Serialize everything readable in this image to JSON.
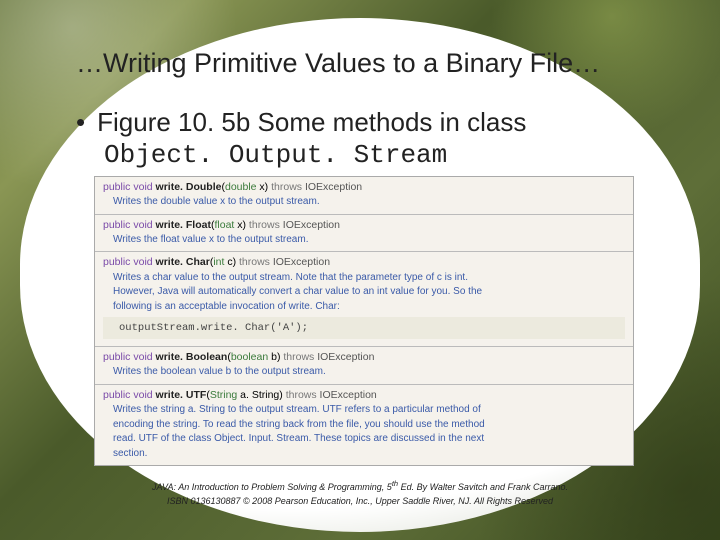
{
  "title": "…Writing Primitive Values to a Binary File…",
  "bullet": "•",
  "bullet_text": "Figure 10. 5b  Some methods in class",
  "class_name": "Object. Output. Stream",
  "methods": [
    {
      "kw1": "public void",
      "name": "write. Double",
      "params_open": "(",
      "type": "double",
      "arg": " x)",
      "thr": " throws ",
      "exc": "IOException",
      "desc": [
        "Writes the double value x to the output stream."
      ]
    },
    {
      "kw1": "public void",
      "name": "write. Float",
      "params_open": "(",
      "type": "float",
      "arg": " x)",
      "thr": " throws ",
      "exc": "IOException",
      "desc": [
        "Writes the float value x to the output stream."
      ]
    },
    {
      "kw1": "public void",
      "name": "write. Char",
      "params_open": "(",
      "type": "int",
      "arg": " c)",
      "thr": " throws ",
      "exc": "IOException",
      "desc": [
        "Writes a char value to the output stream. Note that the parameter type of c is int.",
        "However, Java will automatically convert a char value to an int value for you. So the",
        "following is an acceptable invocation of write. Char:"
      ],
      "code": "outputStream.write. Char('A');"
    },
    {
      "kw1": "public void",
      "name": "write. Boolean",
      "params_open": "(",
      "type": "boolean",
      "arg": " b)",
      "thr": " throws ",
      "exc": "IOException",
      "desc": [
        "Writes the boolean value b to the output stream."
      ]
    },
    {
      "kw1": "public void",
      "name": "write. UTF",
      "params_open": "(",
      "type": "String",
      "arg": " a. String)",
      "thr": " throws ",
      "exc": "IOException",
      "desc": [
        "Writes the string a. String to the output stream. UTF refers to a particular method of",
        "encoding the string. To read the string back from the file, you should use the method",
        "read. UTF of the class Object. Input. Stream. These topics are discussed in the next",
        "section."
      ]
    }
  ],
  "footer1": "JAVA: An Introduction to Problem Solving & Programming, 5",
  "footer1_sup": "th",
  "footer1_tail": " Ed. By Walter Savitch and Frank Carrano.",
  "footer2": "ISBN 0136130887 © 2008 Pearson Education, Inc., Upper Saddle River, NJ. All Rights Reserved"
}
